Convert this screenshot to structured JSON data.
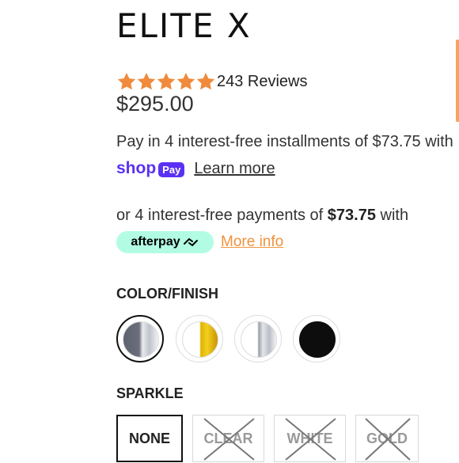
{
  "product": {
    "title": "ELITE X",
    "rating_value": 5,
    "rating_max": 5,
    "reviews": "243 Reviews",
    "price": "$295.00"
  },
  "shop_pay": {
    "installments_text": "Pay in 4 interest-free installments of $73.75 with",
    "brand": "shop",
    "badge": "Pay",
    "learn_more": "Learn more"
  },
  "afterpay": {
    "prefix": "or 4 interest-free payments of ",
    "amount": "$73.75",
    "suffix": " with",
    "brand": "afterpay",
    "more_info": "More info"
  },
  "color_finish": {
    "label": "COLOR/FINISH",
    "options": [
      {
        "name": "silver-black",
        "selected": true
      },
      {
        "name": "gold",
        "selected": false
      },
      {
        "name": "silver",
        "selected": false
      },
      {
        "name": "black",
        "selected": false
      }
    ]
  },
  "sparkle": {
    "label": "SPARKLE",
    "options": [
      {
        "label": "NONE",
        "selected": true,
        "available": true
      },
      {
        "label": "CLEAR",
        "selected": false,
        "available": false
      },
      {
        "label": "WHITE",
        "selected": false,
        "available": false
      },
      {
        "label": "GOLD",
        "selected": false,
        "available": false
      }
    ]
  },
  "colors": {
    "star": "#f08a3c",
    "shop_purple": "#5a31f4",
    "afterpay_mint": "#b2fce4",
    "link_orange": "#f0923a"
  }
}
